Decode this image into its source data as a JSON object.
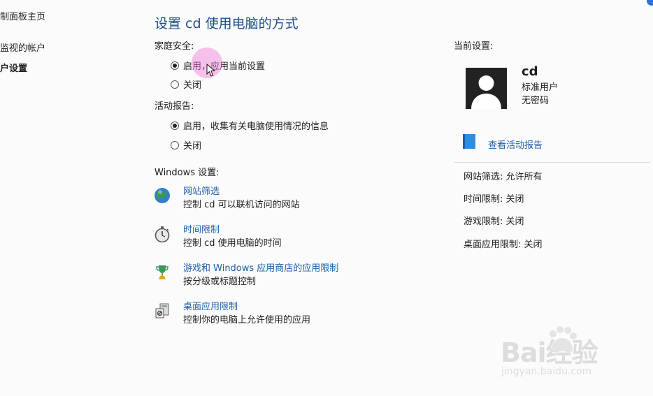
{
  "sidebar": {
    "items": [
      {
        "label": "制面板主页"
      },
      {
        "label": "监视的帐户"
      },
      {
        "label": "户设置"
      }
    ]
  },
  "main": {
    "title": "设置 cd 使用电脑的方式",
    "family_safety": {
      "label": "家庭安全:",
      "options": [
        {
          "label": "启用，应用当前设置",
          "checked": true
        },
        {
          "label": "关闭",
          "checked": false
        }
      ]
    },
    "activity_reports": {
      "label": "活动报告:",
      "options": [
        {
          "label": "启用，收集有关电脑使用情况的信息",
          "checked": true
        },
        {
          "label": "关闭",
          "checked": false
        }
      ]
    },
    "windows_settings": {
      "label": "Windows 设置:",
      "items": [
        {
          "icon": "globe-icon",
          "link": "网站筛选",
          "desc": "控制 cd 可以联机访问的网站"
        },
        {
          "icon": "stopwatch-icon",
          "link": "时间限制",
          "desc": "控制 cd 使用电脑的时间"
        },
        {
          "icon": "trophy-icon",
          "link": "游戏和 Windows 应用商店的应用限制",
          "desc": "按分级或标题控制"
        },
        {
          "icon": "app-restrict-icon",
          "link": "桌面应用限制",
          "desc": "控制你的电脑上允许使用的应用"
        }
      ]
    }
  },
  "current": {
    "label": "当前设置:",
    "user": {
      "name": "cd",
      "type": "标准用户",
      "password": "无密码"
    },
    "report_link": "查看活动报告",
    "status": [
      "网站筛选: 允许所有",
      "时间限制: 关闭",
      "游戏限制: 关闭",
      "桌面应用限制: 关闭"
    ]
  },
  "watermark": {
    "brand": "Bai经验",
    "url": "jingyan.baidu.com"
  },
  "colors": {
    "link": "#1f5fa8",
    "title": "#1f4e8a",
    "highlight": "#f078dc"
  }
}
